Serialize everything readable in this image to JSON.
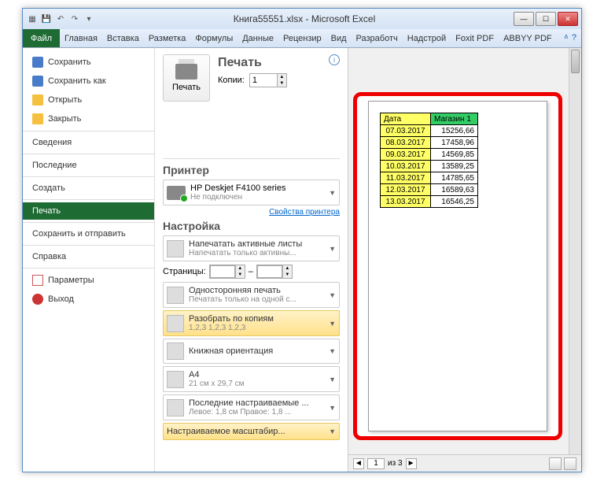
{
  "titlebar": {
    "title": "Книга55551.xlsx - Microsoft Excel"
  },
  "ribbon": {
    "file": "Файл",
    "tabs": [
      "Главная",
      "Вставка",
      "Разметка",
      "Формулы",
      "Данные",
      "Рецензир",
      "Вид",
      "Разработч",
      "Надстрой",
      "Foxit PDF",
      "ABBYY PDF"
    ]
  },
  "sidebar": {
    "save": "Сохранить",
    "saveas": "Сохранить как",
    "open": "Открыть",
    "close": "Закрыть",
    "info": "Сведения",
    "recent": "Последние",
    "new": "Создать",
    "print": "Печать",
    "send": "Сохранить и отправить",
    "help": "Справка",
    "options": "Параметры",
    "exit": "Выход"
  },
  "print": {
    "heading": "Печать",
    "button": "Печать",
    "copies_label": "Копии:",
    "copies_value": "1",
    "printer_heading": "Принтер",
    "printer_name": "HP Deskjet F4100 series",
    "printer_status": "Не подключен",
    "printer_props": "Свойства принтера",
    "settings_heading": "Настройка",
    "opt_active": "Напечатать активные листы",
    "opt_active_sub": "Напечатать только активны...",
    "pages_label": "Страницы:",
    "pages_dash": "–",
    "opt_oneside": "Односторонняя печать",
    "opt_oneside_sub": "Печатать только на одной с...",
    "opt_collate": "Разобрать по копиям",
    "opt_collate_sub": "1,2,3    1,2,3    1,2,3",
    "opt_orient": "Книжная ориентация",
    "opt_a4": "A4",
    "opt_a4_sub": "21 см x 29,7 см",
    "opt_margins": "Последние настраиваемые ...",
    "opt_margins_sub": "Левое: 1,8 см    Правое: 1,8 ...",
    "opt_scale": "Настраиваемое масштабир..."
  },
  "preview": {
    "headers": [
      "Дата",
      "Магазин 1"
    ],
    "rows": [
      [
        "07.03.2017",
        "15256,66"
      ],
      [
        "08.03.2017",
        "17458,96"
      ],
      [
        "09.03.2017",
        "14569,85"
      ],
      [
        "10.03.2017",
        "13589,25"
      ],
      [
        "11.03.2017",
        "14785,65"
      ],
      [
        "12.03.2017",
        "16589,63"
      ],
      [
        "13.03.2017",
        "16546,25"
      ]
    ],
    "page_current": "1",
    "page_sep": "из 3"
  }
}
